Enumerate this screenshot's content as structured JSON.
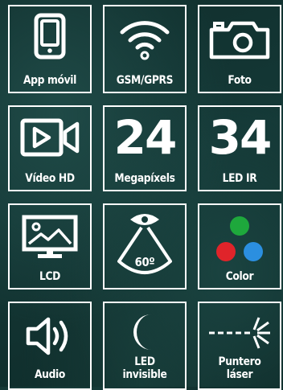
{
  "features": [
    {
      "label": "App móvil",
      "icon": "smartphone-icon"
    },
    {
      "label": "GSM/GPRS",
      "icon": "wifi-signal-icon"
    },
    {
      "label": "Foto",
      "icon": "camera-icon"
    },
    {
      "label": "Vídeo HD",
      "icon": "video-camera-icon",
      "icon_text": "▷"
    },
    {
      "label": "Megapíxels",
      "value": "24"
    },
    {
      "label": "LED IR",
      "value": "34"
    },
    {
      "label": "LCD",
      "icon": "monitor-landscape-icon"
    },
    {
      "label": "",
      "icon": "eye-field-of-view-icon",
      "value": "60º"
    },
    {
      "label": "Color",
      "icon": "rgb-dots-icon",
      "colors": [
        "#1ea83c",
        "#e0242a",
        "#2b8fe0"
      ]
    },
    {
      "label": "Audio",
      "icon": "speaker-icon"
    },
    {
      "label_line1": "LED",
      "label_line2": "invisible",
      "icon": "crescent-moon-icon"
    },
    {
      "label_line1": "Puntero",
      "label_line2": "láser",
      "icon": "laser-pointer-icon"
    }
  ]
}
